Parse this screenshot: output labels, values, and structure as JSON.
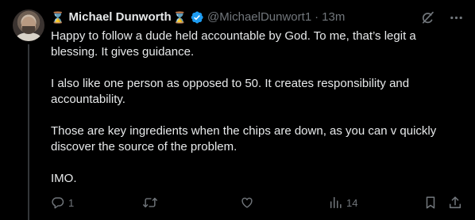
{
  "author": {
    "display_name": "Michael Dunworth",
    "prefix_emoji": "⌛",
    "suffix_emoji": "⌛",
    "handle": "@MichaelDunwort1",
    "separator": "·",
    "time": "13m",
    "verified_color": "#1d9bf0"
  },
  "tweet": {
    "paragraphs": [
      "Happy to follow a dude held accountable by God. To me, that’s legit a blessing. It gives guidance.",
      "I also like one person as opposed to 50. It creates responsibility and accountability.",
      "Those are key ingredients when the chips are down, as you can v quickly discover the source of the problem.",
      "IMO."
    ]
  },
  "actions": {
    "reply_count": "1",
    "repost_count": "",
    "like_count": "",
    "views_count": "14"
  },
  "icons": {
    "grok": "grok-icon",
    "more": "more-icon",
    "reply": "reply-icon",
    "repost": "repost-icon",
    "like": "like-icon",
    "views": "views-icon",
    "bookmark": "bookmark-icon",
    "share": "share-icon"
  }
}
